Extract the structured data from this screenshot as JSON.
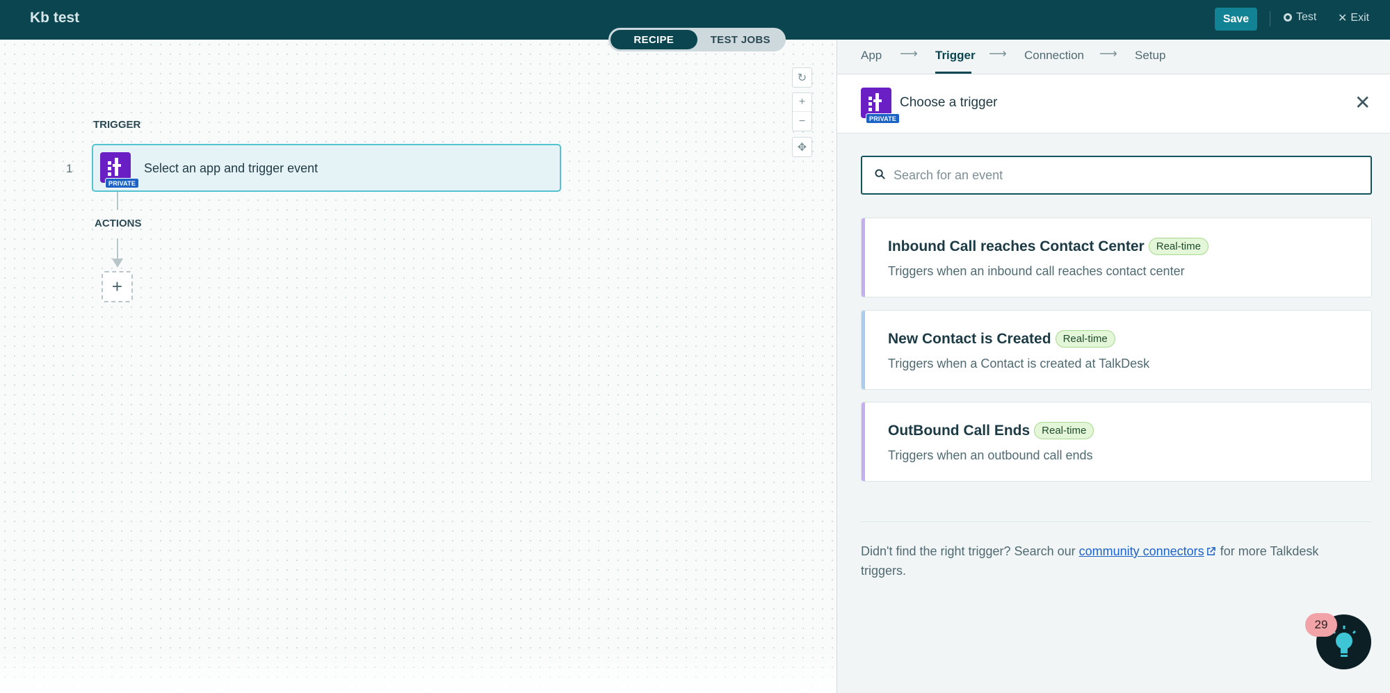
{
  "header": {
    "app_title": "Kb test",
    "save_label": "Save",
    "test_label": "Test",
    "exit_label": "Exit",
    "exit_glyph": "✕"
  },
  "view_toggle": {
    "recipe_label": "RECIPE",
    "test_jobs_label": "TEST JOBS",
    "active": "RECIPE"
  },
  "canvas": {
    "trigger_section_label": "TRIGGER",
    "actions_section_label": "ACTIONS",
    "step_number": "1",
    "trigger_card_text": "Select an app and trigger event",
    "private_badge": "PRIVATE",
    "add_step_glyph": "+",
    "reset_glyph": "↻",
    "zoom_in_glyph": "+",
    "zoom_out_glyph": "−",
    "fit_glyph": "✥"
  },
  "stepper": {
    "steps": [
      "App",
      "Trigger",
      "Connection",
      "Setup"
    ],
    "active_step": "Trigger",
    "arrow_glyph": "⟶"
  },
  "panel": {
    "title": "Choose a trigger",
    "private_badge": "PRIVATE",
    "close_glyph": "✕",
    "search_placeholder": "Search for an event",
    "search_value": "",
    "events": [
      {
        "title": "Inbound Call reaches Contact Center",
        "badge": "Real-time",
        "description": "Triggers when an inbound call reaches contact center",
        "accent": "#c2aef0"
      },
      {
        "title": "New Contact is Created",
        "badge": "Real-time",
        "description": "Triggers when a Contact is created at TalkDesk",
        "accent": "#a9cdf1"
      },
      {
        "title": "OutBound Call Ends",
        "badge": "Real-time",
        "description": "Triggers when an outbound call ends",
        "accent": "#c2aef0"
      }
    ],
    "footer": {
      "prefix": "Didn't find the right trigger? Search our ",
      "link": "community connectors",
      "suffix": " for more Talkdesk triggers."
    }
  },
  "help": {
    "count": "29"
  },
  "colors": {
    "header_bg": "#0b4650",
    "save_button": "#128394",
    "app_logo": "#6a1fc4",
    "private_badge": "#1d63c5",
    "realtime_badge_bg": "#e3f6d7",
    "trigger_card_border": "#55c3cf"
  }
}
